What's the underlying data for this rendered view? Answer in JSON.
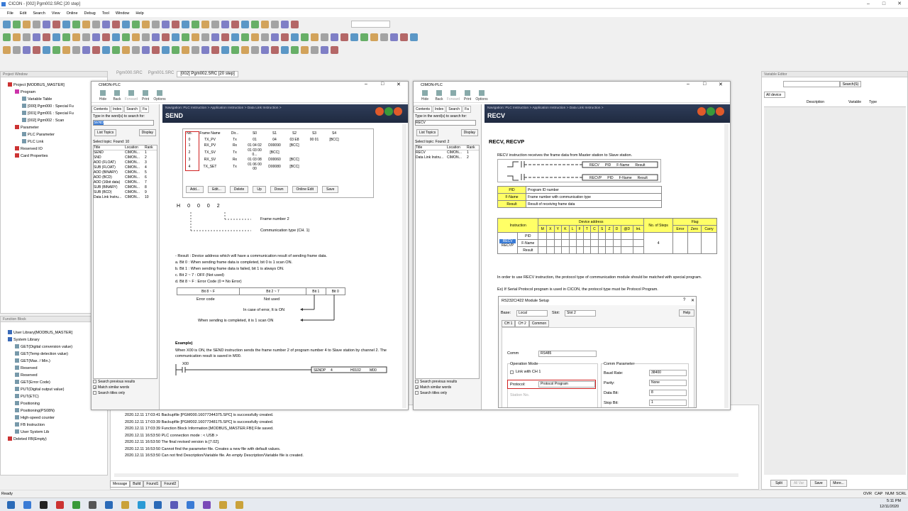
{
  "window": {
    "title": "CICON - [002] Pgm002.SRC [20 step]"
  },
  "menu": [
    "File",
    "Edit",
    "Search",
    "View",
    "Online",
    "Debug",
    "Tool",
    "Window",
    "Help"
  ],
  "project": {
    "panel_title": "Project Window",
    "root": "Project [MODBUS_MASTER]",
    "items": [
      "Program",
      "Variable Table",
      "[000] Pgm000 : Special Fu",
      "[001] Pgm001 : Special Fu",
      "[002] Pgm002 : Scan",
      "Parameter",
      "PLC Parameter",
      "PLC Link",
      "Reserved IO",
      "Card Properties"
    ]
  },
  "editor_tabs": [
    "Pgm000.SRC",
    "Pgm001.SRC",
    "[002] Pgm002.SRC [20 step]"
  ],
  "function_block": {
    "panel_title": "Function Block",
    "items": [
      "User Library[MODBUS_MASTER]",
      "System Library",
      "GET(Digital conversion value)",
      "GET(Temp detection value)",
      "GET(Max. / Min.)",
      "Reserved",
      "Reserved",
      "GET(Error Code)",
      "PUT(Digital output value)",
      "PUT(ETC)",
      "Positioning",
      "Positioning(PS08N)",
      "High-speed counter",
      "FB Instruction",
      "User System Lib",
      "Deleted FB(Empty)"
    ]
  },
  "help1": {
    "title": "CIMON-PLC",
    "toolbar": [
      "Hide",
      "Back",
      "Forward",
      "Print",
      "Options"
    ],
    "tabs": [
      "Contents",
      "Index",
      "Search",
      "Fa"
    ],
    "search_label": "Type in the word(s) to search for:",
    "search_value": "SEND",
    "list_topics": "List Topics",
    "display": "Display",
    "select_topic": "Select topic:",
    "found": "Found: 10",
    "col_title": "Title",
    "col_location": "Location",
    "col_rank": "Rank",
    "topics": [
      [
        "SEND",
        "CIMON...",
        "1"
      ],
      [
        "SND",
        "CIMON...",
        "2"
      ],
      [
        "ADD (FLOAT)",
        "CIMON...",
        "3"
      ],
      [
        "SUB (FLOAT)",
        "CIMON...",
        "4"
      ],
      [
        "ADD (BINARY)",
        "CIMON...",
        "5"
      ],
      [
        "ADD (BCD)",
        "CIMON...",
        "6"
      ],
      [
        "ADD (16bit data)",
        "CIMON...",
        "7"
      ],
      [
        "SUB (BINARY)",
        "CIMON...",
        "8"
      ],
      [
        "SUB (BCD)",
        "CIMON...",
        "9"
      ],
      [
        "Data Link Instru...",
        "CIMON...",
        "10"
      ]
    ],
    "opts": [
      "Search previous results",
      "Match similar words",
      "Search titles only"
    ],
    "nav": "Navigation: PLC Instruction > Application Instruction > Data Link Instruction >",
    "heading": "SEND",
    "frame_cols": [
      "No.",
      "Frame Name",
      "Dir...",
      "S0",
      "S1",
      "S2",
      "S3",
      "S4"
    ],
    "frame_rows": [
      [
        "0",
        "TX_PV",
        "Tx",
        "01",
        "04",
        "03 E8",
        "00 01",
        "[BCC]"
      ],
      [
        "1",
        "RX_PV",
        "Rx",
        "01 04 02",
        "D00090",
        "[BCC]",
        "",
        ""
      ],
      [
        "2",
        "TX_SV",
        "Tx",
        "01 03 00 0...",
        "[BCC]",
        "",
        "",
        ""
      ],
      [
        "3",
        "RX_SV",
        "Rx",
        "01 03 08",
        "D00060",
        "[BCC]",
        "",
        ""
      ],
      [
        "4",
        "TX_SET",
        "Tx",
        "01 06 00 00",
        "D00080",
        "[BCC]",
        "",
        ""
      ]
    ],
    "frame_btns": [
      "Add...",
      "Edit...",
      "Delete",
      "Up",
      "Down",
      "Online Edit",
      "Save"
    ],
    "hcode": [
      "H",
      "0",
      "0",
      "0",
      "2"
    ],
    "frame_number": "Frame number 2",
    "comm_type": "Communication type (CH. 1)",
    "result_lines": [
      "- Result : Device address which will have a communication result of sending frame data.",
      "a. Bit 0 : When sending frame data is completed, bit 0 is 1 scan ON.",
      "b. Bit 1 : When sending frame data is failed, bit 1 is always ON.",
      "c. Bit 2 ~ 7 : OFF (Not used)",
      "d. Bit 8 ~ F : Error Code (0 = No Error)"
    ],
    "bit_cols": [
      "Bit 8 ~ F",
      "Bit 2 ~ 7",
      "Bit 1",
      "Bit 0"
    ],
    "error_code": "Error code",
    "not_used": "Not used",
    "err_on": "In case of error, It is ON",
    "send_on": "When sending is completed, it is 1 scan ON",
    "example": "Example)",
    "example_text": "When X00 is ON, the SEND instruction sends the frame number 2 of program number 4 to Slave station by channel 2. The communication result is saved in M00.",
    "ladder": [
      "X00",
      "SENDP",
      "4",
      "H0102",
      "M00"
    ]
  },
  "help2": {
    "title": "CIMON-PLC",
    "search_value": "RECV",
    "found": "Found: 2",
    "topics": [
      [
        "RECV",
        "CIMON...",
        "1"
      ],
      [
        "Data Link Instru...",
        "CIMON...",
        "2"
      ]
    ],
    "nav": "Navigation: PLC Instruction > Application Instruction > Data Link Instruction >",
    "heading": "RECV",
    "subheading": "RECV, RECVP",
    "intro": "RECV instruction receives the frame data from Master station to Slave station.",
    "ladder1": [
      "RECV",
      "PID",
      "F-Name",
      "Result"
    ],
    "ladder2": [
      "RECVP",
      "PID",
      "F-Name",
      "Result"
    ],
    "params": [
      [
        "PID",
        "Program ID number"
      ],
      [
        "F-Name",
        "Frame number with communication type"
      ],
      [
        "Result",
        "Result of receiving frame data"
      ]
    ],
    "dev_header": "Device address",
    "instr": "Instruction",
    "steps": "No. of Steps",
    "flag": "Flag",
    "dev_cols": [
      "M",
      "X",
      "Y",
      "K",
      "L",
      "F",
      "T",
      "C",
      "S",
      "Z",
      "D",
      "@D",
      "Int."
    ],
    "flag_cols": [
      "Error",
      "Zero",
      "Carry"
    ],
    "dev_rows": [
      "PID",
      "F-Name",
      "Result"
    ],
    "names": [
      "RECV",
      "RECVP"
    ],
    "step_val": "4",
    "note1": "In order to use RECV instruction, the protocol type of communication module should be matched with special program.",
    "note2": "Ex) If Serial Protocol program is used in CICON, the protocol type must be Protocol Program."
  },
  "rs": {
    "title": "RS232C/422 Module Setup",
    "base_label": "Base:",
    "base": "Local",
    "slot_label": "Slot:",
    "slot": "Slot 2",
    "help": "Help",
    "tabs": [
      "CH 1",
      "CH 2",
      "Common"
    ],
    "comm_label": "Comm",
    "comm": "RS485",
    "op_mode": "Operation Mode",
    "link": "Link with CH 1",
    "protocol_label": "Protocol:",
    "protocol": "Protocol Program",
    "station": "Station No.",
    "comm_param": "Comm Parameter",
    "baud_label": "Baud Rate:",
    "baud": "38400",
    "parity_label": "Parity:",
    "parity": "None",
    "data_label": "Data Bit:",
    "data": "8",
    "stop_label": "Stop Bit:",
    "stop": "1"
  },
  "messages": [
    "2020.12.11 17:03:41    Backupfile [PGM000.16077344375.SPC] is successfully created.",
    "2020.12.11 17:03:39    Backupfile [PGM002.16077348175.SPC] is successfully created.",
    "2020.12.11 17:03:39    Function Block Information [MODBUS_MASTER.FBI] File saved.",
    "2020.12.11 16:53:50    PLC connection mode : < USB >",
    "2020.12.11 16:53:50    The final revised version is [7.02].",
    "2020.12.11 16:53:50    Cannot find the parameter file. Creates a new file with default values.",
    "2020.12.11 16:53:50    Can not find Description/Variable file. An empty Description/Variable file is created."
  ],
  "msg_tabs": [
    "Message",
    "Build",
    "Found1",
    "Found2"
  ],
  "variable": {
    "panel_title": "Variable Editor",
    "all_device": "All device",
    "search": "Search(S)",
    "cols": [
      "Description",
      "Variable",
      "Type"
    ],
    "btns": [
      "Split",
      "All Var",
      "Save",
      "More..."
    ]
  },
  "status": {
    "ready": "Ready",
    "ovr": "OVR",
    "cap": "CAP",
    "num": "NUM",
    "scrl": "SCRL",
    "time": "5:11 PM",
    "date": "12/11/2020"
  },
  "colors": {
    "nav": "#1f2a40",
    "accent": "#3a7bd5",
    "red": "#d02020",
    "yellow": "#ffff66"
  }
}
